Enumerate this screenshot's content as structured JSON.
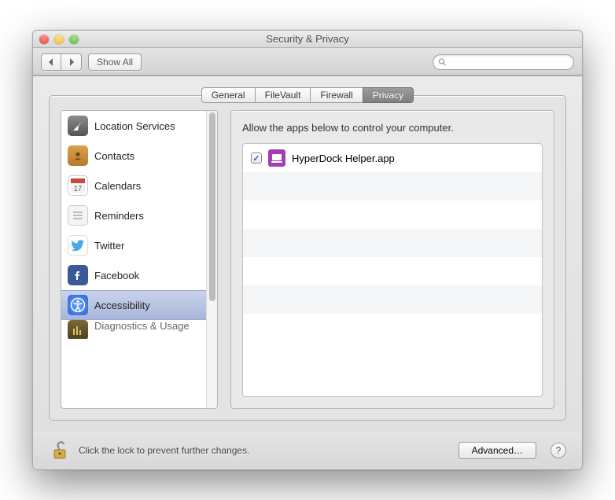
{
  "window": {
    "title": "Security & Privacy"
  },
  "toolbar": {
    "show_all": "Show All",
    "search_placeholder": ""
  },
  "tabs": [
    {
      "label": "General",
      "active": false
    },
    {
      "label": "FileVault",
      "active": false
    },
    {
      "label": "Firewall",
      "active": false
    },
    {
      "label": "Privacy",
      "active": true
    }
  ],
  "sidebar": {
    "items": [
      {
        "label": "Location Services",
        "icon": "location-icon"
      },
      {
        "label": "Contacts",
        "icon": "contacts-icon"
      },
      {
        "label": "Calendars",
        "icon": "calendar-icon"
      },
      {
        "label": "Reminders",
        "icon": "reminders-icon"
      },
      {
        "label": "Twitter",
        "icon": "twitter-icon"
      },
      {
        "label": "Facebook",
        "icon": "facebook-icon"
      },
      {
        "label": "Accessibility",
        "icon": "accessibility-icon",
        "selected": true
      },
      {
        "label": "Diagnostics & Usage",
        "icon": "diagnostics-icon",
        "cut": true
      }
    ]
  },
  "detail": {
    "heading": "Allow the apps below to control your computer.",
    "apps": [
      {
        "name": "HyperDock Helper.app",
        "checked": true
      }
    ]
  },
  "footer": {
    "lock_text": "Click the lock to prevent further changes.",
    "advanced": "Advanced…"
  }
}
